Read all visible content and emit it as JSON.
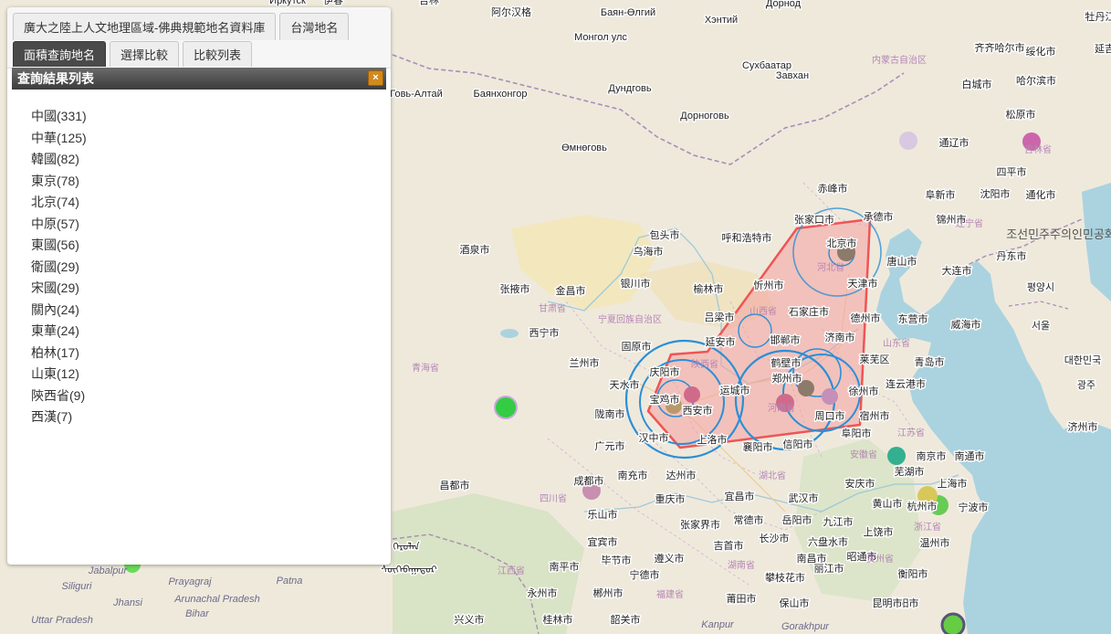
{
  "tabs_top": [
    "廣大之陸上人文地理區域-佛典規範地名資料庫",
    "台灣地名"
  ],
  "tabs_sub": [
    "面積查詢地名",
    "選擇比較",
    "比較列表"
  ],
  "panel_title": "查詢結果列表",
  "close_label": "×",
  "results": [
    "中國(331)",
    "中華(125)",
    "韓國(82)",
    "東京(78)",
    "北京(74)",
    "中原(57)",
    "東國(56)",
    "衛國(29)",
    "宋國(29)",
    "關內(24)",
    "東華(24)",
    "柏林(17)",
    "山東(12)",
    "陝西省(9)",
    "西漢(7)"
  ],
  "map_labels": {
    "cities": [
      "阿尔汉格",
      "Монгол улс",
      "Хэнтий",
      "Сухбаатар",
      "Дорнод",
      "Дундговь",
      "Дорноговь",
      "Өмнөговь",
      "Говь-Алтай",
      "Баянхонгор",
      "内蒙古自治区",
      "齐齐哈尔市",
      "绥化市",
      "白城市",
      "哈尔滨市",
      "松原市",
      "通辽市",
      "四平市",
      "吉林省",
      "赤峰市",
      "阜新市",
      "沈阳市",
      "通化市",
      "张家口市",
      "承德市",
      "锦州市",
      "辽宁省",
      "包头市",
      "呼和浩特市",
      "乌海市",
      "北京市",
      "唐山市",
      "大连市",
      "丹东市",
      "조선민주주의인민공화국",
      "酒泉市",
      "河北省",
      "天津市",
      "평양시",
      "张掖市",
      "金昌市",
      "银川市",
      "榆林市",
      "忻州市",
      "甘肃省",
      "宁夏回族自治区",
      "石家庄市",
      "吕梁市",
      "山西省",
      "德州市",
      "东营市",
      "威海市",
      "서울",
      "西宁市",
      "延安市",
      "邯郸市",
      "济南市",
      "山东省",
      "固原市",
      "대한민국",
      "青海省",
      "兰州市",
      "庆阳市",
      "陕西省",
      "鹤壁市",
      "莱芜区",
      "青岛市",
      "天水市",
      "郑州市",
      "连云港市",
      "광주",
      "运城市",
      "徐州市",
      "宝鸡市",
      "西安市",
      "河南省",
      "陇南市",
      "周口市",
      "宿州市",
      "济州市",
      "汉中市",
      "上洛市",
      "阜阳市",
      "广元市",
      "襄阳市",
      "信阳市",
      "江苏省",
      "安徽省",
      "南京市",
      "南通市",
      "芜湖市",
      "上海市",
      "南充市",
      "达州市",
      "湖北省",
      "安庆市",
      "成都市",
      "昌都市",
      "四川省",
      "重庆市",
      "宜昌市",
      "武汉市",
      "黄山市",
      "杭州市",
      "宁波市",
      "浙江省",
      "乐山市",
      "张家界市",
      "常德市",
      "岳阳市",
      "九江市",
      "宜宾市",
      "吉首市",
      "长沙市",
      "上饶市",
      "温州市",
      "毕节市",
      "遵义市",
      "湖南省",
      "南昌市",
      "丽江市",
      "昭通市",
      "贵州省",
      "衡阳市",
      "江西省",
      "南平市",
      "宁德市",
      "攀枝花市",
      "六盘水市",
      "贵阳市",
      "永州市",
      "郴州市",
      "福建省",
      "莆田市",
      "保山市",
      "昆明市",
      "兴义市",
      "桂林市",
      "韶关市",
      "Kanpur",
      "Gorakhpur",
      "Siliguri",
      "Prayagraj",
      "Patna",
      "Jhansi",
      "Bihar",
      "Uttar Pradesh",
      "Arunachal Pradesh",
      "Jabalpur",
      "ᠬᠡᠷᠦᠯᠡᠨ",
      "ᠰᠦᠬᠡᠪᠠᠭᠠᠲᠤᠷ",
      "Баян-Өлгий",
      "Завхан",
      "Иркутск",
      "伊春",
      "吉林",
      "牡丹江",
      "延吉"
    ]
  },
  "colors": {
    "polygon_fill": "#f4a0a0",
    "polygon_stroke": "#ee5555",
    "circle_stroke": "#2a8fd6",
    "marker_green": "#33cc44",
    "marker_pink": "#cc66aa",
    "tab_active": "#4a4a4a"
  }
}
